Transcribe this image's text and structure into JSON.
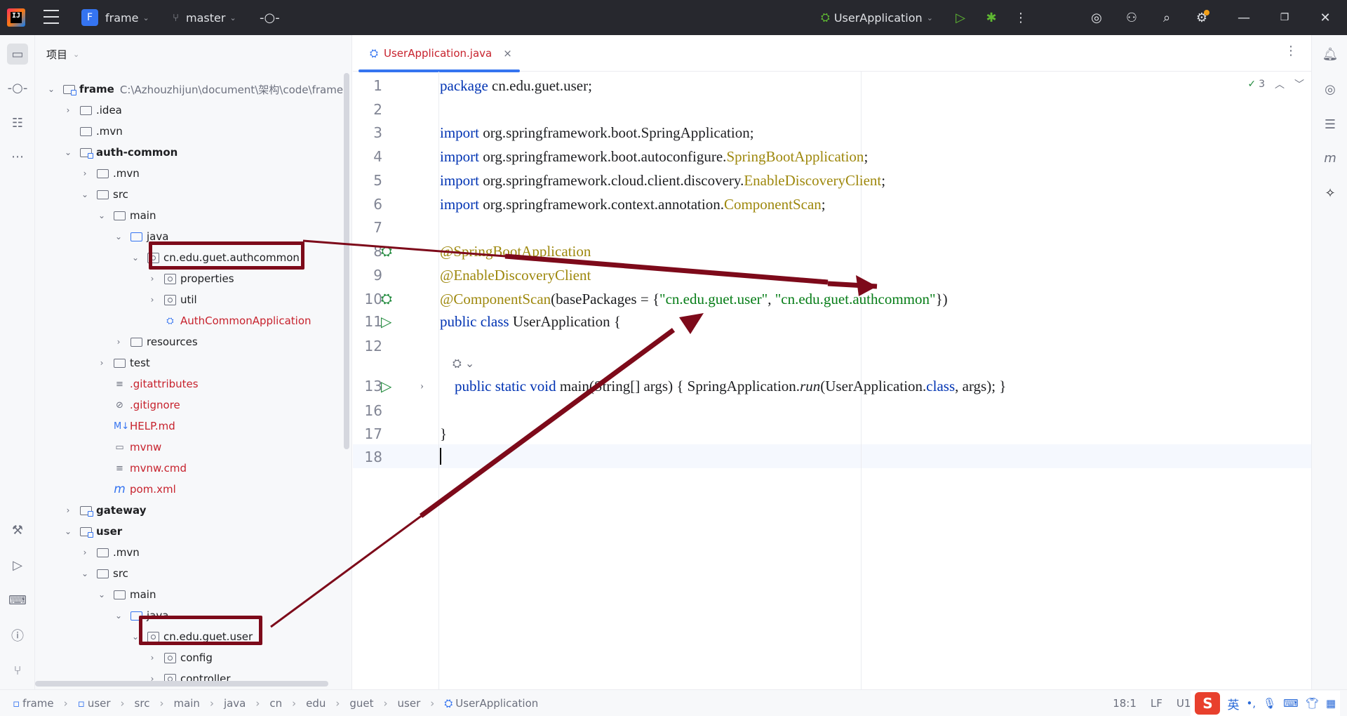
{
  "titlebar": {
    "project_name": "frame",
    "project_badge": "F",
    "branch": "master",
    "run_config": "UserApplication"
  },
  "project_panel": {
    "header": "项目",
    "tree": [
      {
        "label": "frame",
        "path": "C:\\Azhouzhijun\\document\\架构\\code\\frame",
        "bold": true,
        "type": "module",
        "arrow": "⌄",
        "depth": 0
      },
      {
        "label": ".idea",
        "type": "folder",
        "arrow": "›",
        "depth": 1
      },
      {
        "label": ".mvn",
        "type": "folder",
        "arrow": "",
        "depth": 1
      },
      {
        "label": "auth-common",
        "bold": true,
        "type": "module",
        "arrow": "⌄",
        "depth": 1
      },
      {
        "label": ".mvn",
        "type": "folder",
        "arrow": "›",
        "depth": 2
      },
      {
        "label": "src",
        "type": "folder",
        "arrow": "⌄",
        "depth": 2
      },
      {
        "label": "main",
        "type": "folder",
        "arrow": "⌄",
        "depth": 3
      },
      {
        "label": "java",
        "type": "src",
        "arrow": "⌄",
        "depth": 4
      },
      {
        "label": "cn.edu.guet.authcommon",
        "type": "package",
        "arrow": "⌄",
        "depth": 5
      },
      {
        "label": "properties",
        "type": "package",
        "arrow": "›",
        "depth": 6
      },
      {
        "label": "util",
        "type": "package",
        "arrow": "›",
        "depth": 6
      },
      {
        "label": "AuthCommonApplication",
        "type": "class",
        "red": true,
        "arrow": "",
        "depth": 6
      },
      {
        "label": "resources",
        "type": "folder",
        "arrow": "›",
        "depth": 4
      },
      {
        "label": "test",
        "type": "folder",
        "arrow": "›",
        "depth": 3
      },
      {
        "label": ".gitattributes",
        "type": "file",
        "icon": "≡",
        "red": true,
        "arrow": "",
        "depth": 3
      },
      {
        "label": ".gitignore",
        "type": "file",
        "icon": "⊘",
        "red": true,
        "arrow": "",
        "depth": 3
      },
      {
        "label": "HELP.md",
        "type": "file",
        "icon": "M↓",
        "red": true,
        "arrow": "",
        "depth": 3
      },
      {
        "label": "mvnw",
        "type": "file",
        "icon": "▭",
        "red": true,
        "arrow": "",
        "depth": 3
      },
      {
        "label": "mvnw.cmd",
        "type": "file",
        "icon": "≡",
        "red": true,
        "arrow": "",
        "depth": 3
      },
      {
        "label": "pom.xml",
        "type": "file",
        "icon": "m",
        "red": true,
        "arrow": "",
        "depth": 3
      },
      {
        "label": "gateway",
        "bold": true,
        "type": "module",
        "arrow": "›",
        "depth": 1
      },
      {
        "label": "user",
        "bold": true,
        "type": "module",
        "arrow": "⌄",
        "depth": 1
      },
      {
        "label": ".mvn",
        "type": "folder",
        "arrow": "›",
        "depth": 2
      },
      {
        "label": "src",
        "type": "folder",
        "arrow": "⌄",
        "depth": 2
      },
      {
        "label": "main",
        "type": "folder",
        "arrow": "⌄",
        "depth": 3
      },
      {
        "label": "java",
        "type": "src",
        "arrow": "⌄",
        "depth": 4
      },
      {
        "label": "cn.edu.guet.user",
        "type": "package",
        "arrow": "⌄",
        "depth": 5
      },
      {
        "label": "config",
        "type": "package",
        "arrow": "›",
        "depth": 6
      },
      {
        "label": "controller",
        "type": "package",
        "arrow": "›",
        "depth": 6
      }
    ]
  },
  "editor": {
    "tab_label": "UserApplication.java",
    "inspection_count": "3",
    "lines": [
      {
        "num": "1",
        "tokens": [
          {
            "t": "package",
            "c": "kw"
          },
          {
            "t": " cn.edu.guet.user;"
          }
        ]
      },
      {
        "num": "2",
        "tokens": []
      },
      {
        "num": "3",
        "tokens": [
          {
            "t": "import",
            "c": "kw"
          },
          {
            "t": " org.springframework.boot.SpringApplication;"
          }
        ]
      },
      {
        "num": "4",
        "tokens": [
          {
            "t": "import",
            "c": "kw"
          },
          {
            "t": " org.springframework.boot.autoconfigure."
          },
          {
            "t": "SpringBootApplication",
            "c": "ann"
          },
          {
            "t": ";"
          }
        ]
      },
      {
        "num": "5",
        "tokens": [
          {
            "t": "import",
            "c": "kw"
          },
          {
            "t": " org.springframework.cloud.client.discovery."
          },
          {
            "t": "EnableDiscoveryClient",
            "c": "ann"
          },
          {
            "t": ";"
          }
        ]
      },
      {
        "num": "6",
        "tokens": [
          {
            "t": "import",
            "c": "kw"
          },
          {
            "t": " org.springframework.context.annotation."
          },
          {
            "t": "ComponentScan",
            "c": "ann"
          },
          {
            "t": ";"
          }
        ]
      },
      {
        "num": "7",
        "tokens": []
      },
      {
        "num": "8",
        "tokens": [
          {
            "t": "@SpringBootApplication",
            "c": "ann"
          }
        ],
        "gutter": "bean"
      },
      {
        "num": "9",
        "tokens": [
          {
            "t": "@EnableDiscoveryClient",
            "c": "ann"
          }
        ]
      },
      {
        "num": "10",
        "tokens": [
          {
            "t": "@ComponentScan",
            "c": "ann"
          },
          {
            "t": "(basePackages = {"
          },
          {
            "t": "\"cn.edu.guet.user\"",
            "c": "str"
          },
          {
            "t": ", "
          },
          {
            "t": "\"cn.edu.guet.authcommon\"",
            "c": "str"
          },
          {
            "t": "})"
          }
        ],
        "gutter": "bean"
      },
      {
        "num": "11",
        "tokens": [
          {
            "t": "public class",
            "c": "kw"
          },
          {
            "t": " UserApplication {"
          }
        ],
        "gutter": "run"
      },
      {
        "num": "12",
        "tokens": []
      },
      {
        "num": "13",
        "tokens": [
          {
            "t": "    "
          },
          {
            "t": "public static void",
            "c": "kw"
          },
          {
            "t": " main(String[] args) { SpringApplication."
          },
          {
            "t": "run",
            "c": "it"
          },
          {
            "t": "(UserApplication."
          },
          {
            "t": "class",
            "c": "kw"
          },
          {
            "t": ", args); }"
          }
        ],
        "gutter": "run",
        "fold": true
      },
      {
        "num": "16",
        "tokens": []
      },
      {
        "num": "17",
        "tokens": [
          {
            "t": "}"
          }
        ]
      },
      {
        "num": "18",
        "tokens": []
      }
    ]
  },
  "statusbar": {
    "breadcrumbs": [
      "frame",
      "user",
      "src",
      "main",
      "java",
      "cn",
      "edu",
      "guet",
      "user",
      "UserApplication"
    ],
    "position": "18:1",
    "line_sep": "LF",
    "encoding": "U1",
    "ime_lang": "英"
  },
  "colors": {
    "accent": "#3574f0",
    "annotation_box": "#7d0a1a",
    "keyword": "#0033b3",
    "annotation": "#9e880d",
    "string": "#067d17"
  }
}
